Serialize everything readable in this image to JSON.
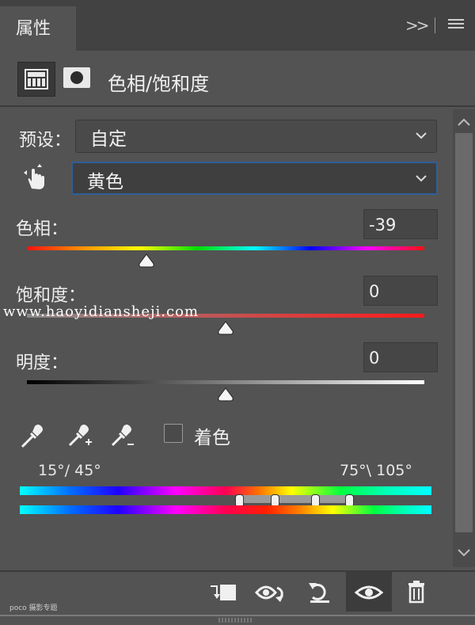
{
  "panel": {
    "tab_title": "属性",
    "adjustment_title": "色相/饱和度"
  },
  "preset": {
    "label": "预设：",
    "value": "自定"
  },
  "channel": {
    "value": "黄色"
  },
  "hue": {
    "label": "色相：",
    "value": "-39",
    "slider_fraction": 0.3
  },
  "saturation": {
    "label": "饱和度：",
    "value": "0",
    "slider_fraction": 0.5
  },
  "lightness": {
    "label": "明度：",
    "value": "0",
    "slider_fraction": 0.5
  },
  "colorize": {
    "label": "着色",
    "checked": false
  },
  "range": {
    "left_readout": "15°/ 45°",
    "right_readout": "75°\\ 105°"
  },
  "watermark": "www.haoyidiansheji.com",
  "footer": {
    "credit": "poco 摄影专题"
  },
  "icons": {
    "expand": "double-chevron-right-icon",
    "menu": "hamburger-menu-icon",
    "adjustment_layer": "hue-saturation-icon",
    "mask": "mask-icon",
    "targeted_adjust": "hand-adjust-icon",
    "eyedropper": "eyedropper-icon",
    "eyedropper_add": "eyedropper-add-icon",
    "eyedropper_subtract": "eyedropper-subtract-icon",
    "clip": "clip-to-layer-icon",
    "view_previous": "view-previous-state-icon",
    "reset": "reset-icon",
    "visibility": "eye-icon",
    "delete": "trash-icon"
  },
  "colors": {
    "panel_bg": "#535353",
    "tabbar_bg": "#424242",
    "focus_border": "#2f5f9a"
  }
}
